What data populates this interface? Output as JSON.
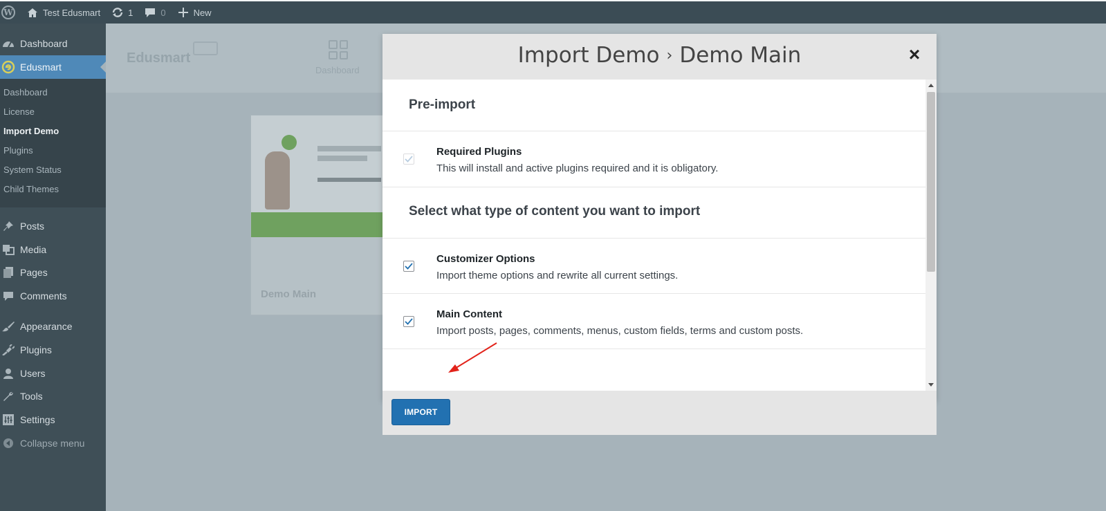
{
  "admin_bar": {
    "site_name": "Test Edusmart",
    "updates_count": "1",
    "comments_count": "0",
    "new_label": "New"
  },
  "sidebar": {
    "dashboard": "Dashboard",
    "edusmart": "Edusmart",
    "submenu": [
      "Dashboard",
      "License",
      "Import Demo",
      "Plugins",
      "System Status",
      "Child Themes"
    ],
    "posts": "Posts",
    "media": "Media",
    "pages": "Pages",
    "comments": "Comments",
    "appearance": "Appearance",
    "plugins": "Plugins",
    "users": "Users",
    "tools": "Tools",
    "settings": "Settings",
    "collapse": "Collapse menu"
  },
  "background": {
    "brand": "Edusmart",
    "dashboard_label": "Dashboard",
    "demo_title": "Demo Main"
  },
  "modal": {
    "title_part1": "Import Demo",
    "separator": "›",
    "title_part2": "Demo Main",
    "close": "×",
    "pre_import_heading": "Pre-import",
    "required_plugins": {
      "title": "Required Plugins",
      "desc": "This will install and active plugins required and it is obligatory."
    },
    "content_heading": "Select what type of content you want to import",
    "customizer": {
      "title": "Customizer Options",
      "desc": "Import theme options and rewrite all current settings."
    },
    "main_content": {
      "title": "Main Content",
      "desc": "Import posts, pages, comments, menus, custom fields, terms and custom posts."
    },
    "import_button": "IMPORT"
  },
  "colors": {
    "accent": "#2271b1",
    "sidebar_bg": "#3f4f57",
    "active_menu": "#4f89b8",
    "annotation_arrow": "#e2231a"
  }
}
